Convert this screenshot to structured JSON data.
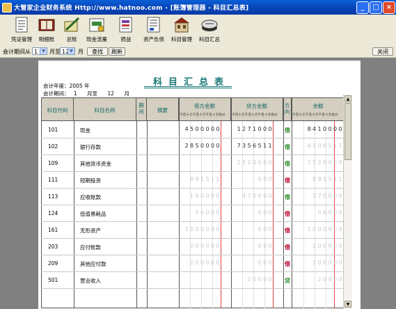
{
  "window": {
    "title": "大管家企业财务系统 Http://www.hatnoo.com - [账簿管理器 - 科目汇总表]"
  },
  "toolbar": {
    "items": [
      {
        "label": "凭证管理",
        "icon": "voucher-icon"
      },
      {
        "label": "明细账",
        "icon": "ledger-icon"
      },
      {
        "label": "总账",
        "icon": "general-ledger-icon"
      },
      {
        "label": "现金流量",
        "icon": "cashflow-icon"
      },
      {
        "label": "损益",
        "icon": "profit-loss-icon"
      },
      {
        "label": "资产负债",
        "icon": "balance-sheet-icon"
      },
      {
        "label": "科目管理",
        "icon": "account-management-icon"
      },
      {
        "label": "科目汇总",
        "icon": "account-summary-icon"
      }
    ]
  },
  "filter": {
    "period_label": "会计期间从",
    "from_month": "1",
    "month_to_label": "月至",
    "to_month": "12",
    "month_label": "月",
    "query_button": "查找",
    "refresh_button": "刷新",
    "close_button": "关闭"
  },
  "report": {
    "title": "科目汇总表",
    "year_line": "会计年度：2005 年",
    "period_label": "会计期间：",
    "period_from": "1",
    "period_mid": "月至",
    "period_to": "12",
    "period_end": "月",
    "headers": {
      "code": "科目代码",
      "name": "科目名称",
      "period": "期间",
      "abstract": "摘要",
      "debit": "借方金额",
      "credit": "贷方金额",
      "direction": "方向",
      "balance": "余额"
    },
    "digit_units": "千百十亿千百十万千百十元角分",
    "rows": [
      {
        "code": "101",
        "name": "现金",
        "debit": "4500000",
        "credit": "1271000",
        "dir": "借",
        "balance": "8410000"
      },
      {
        "code": "102",
        "name": "银行存款",
        "debit": "2850000",
        "credit": "7356511",
        "dir": "借",
        "balance": "4506511"
      },
      {
        "code": "109",
        "name": "其他货币资金",
        "debit": "",
        "credit": "1520000",
        "dir": "借",
        "balance": "1520000"
      },
      {
        "code": "111",
        "name": "短期投资",
        "debit": "891511",
        "credit": "000",
        "dir": "借",
        "balance": "891511"
      },
      {
        "code": "113",
        "name": "应收账款",
        "debit": "100000",
        "credit": "470000",
        "dir": "借",
        "balance": "370000"
      },
      {
        "code": "124",
        "name": "低值易耗品",
        "debit": "56000",
        "credit": "000",
        "dir": "借",
        "balance": "56000"
      },
      {
        "code": "161",
        "name": "无形资产",
        "debit": "1000000",
        "credit": "000",
        "dir": "借",
        "balance": "1000000"
      },
      {
        "code": "203",
        "name": "应付账款",
        "debit": "200000",
        "credit": "000",
        "dir": "借",
        "balance": "200000"
      },
      {
        "code": "209",
        "name": "其他应付款",
        "debit": "200000",
        "credit": "000",
        "dir": "借",
        "balance": "200000"
      },
      {
        "code": "501",
        "name": "营业收入",
        "debit": "",
        "credit": "20000",
        "dir": "贷",
        "balance": "20000"
      }
    ]
  },
  "colors": {
    "accent": "#1a7878",
    "dir_debit": "#b8002a",
    "dir_credit": "#2a8a2a"
  }
}
